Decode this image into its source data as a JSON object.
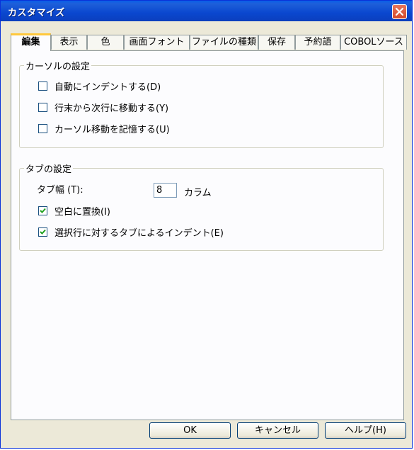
{
  "window": {
    "title": "カスタマイズ"
  },
  "tabs": [
    "編集",
    "表示",
    "色",
    "画面フォント",
    "ファイルの種類",
    "保存",
    "予約語",
    "COBOLソース"
  ],
  "cursor_group": {
    "legend": "カーソルの設定",
    "options": [
      {
        "label": "自動にインデントする(D)",
        "checked": false
      },
      {
        "label": "行末から次行に移動する(Y)",
        "checked": false
      },
      {
        "label": "カーソル移動を記憶する(U)",
        "checked": false
      }
    ]
  },
  "tab_group": {
    "legend": "タブの設定",
    "width_label": "タブ幅 (T):",
    "width_value": "8",
    "width_unit": "カラム",
    "options": [
      {
        "label": "空白に置換(I)",
        "checked": true
      },
      {
        "label": "選択行に対するタブによるインデント(E)",
        "checked": true
      }
    ]
  },
  "buttons": {
    "ok": "OK",
    "cancel": "キャンセル",
    "help": "ヘルプ(H)"
  },
  "icons": {
    "close": "close-icon",
    "check": "checkmark-icon"
  }
}
